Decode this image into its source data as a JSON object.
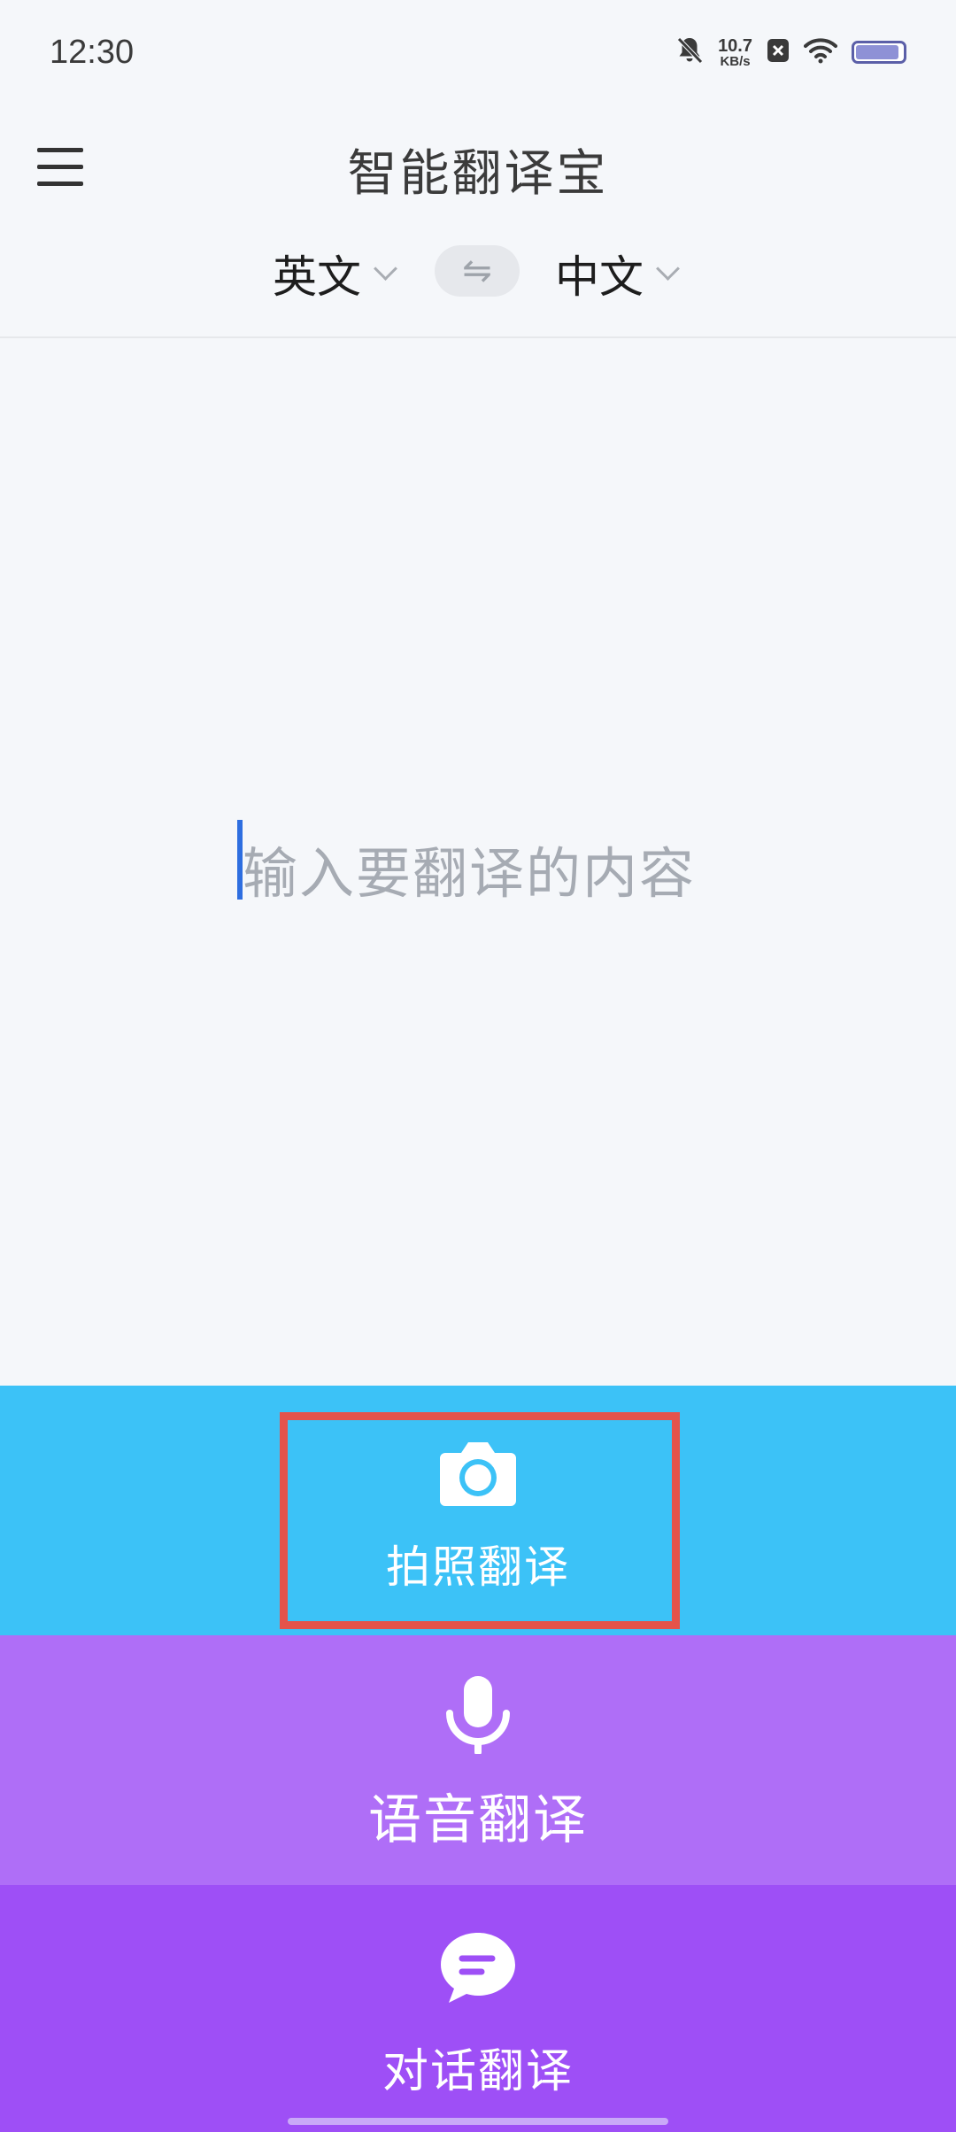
{
  "status_bar": {
    "time": "12:30",
    "net_speed_value": "10.7",
    "net_speed_unit": "KB/s",
    "icons": [
      "mute-bell-icon",
      "close-box-icon",
      "wifi-icon",
      "battery-icon"
    ],
    "battery_level": 0.85
  },
  "header": {
    "title": "智能翻译宝",
    "menu_icon": "hamburger-menu-icon",
    "source_lang": "英文",
    "target_lang": "中文",
    "swap_glyph": "⇋"
  },
  "input": {
    "placeholder": "输入要翻译的内容"
  },
  "actions": {
    "photo": {
      "label": "拍照翻译",
      "icon": "camera-icon",
      "color": "#3cc2f7"
    },
    "voice": {
      "label": "语音翻译",
      "icon": "microphone-icon",
      "color": "#af6ef7"
    },
    "chat": {
      "label": "对话翻译",
      "icon": "chat-bubble-icon",
      "color": "#9e4ff6"
    }
  },
  "colors": {
    "highlight": "#e5534b",
    "caret": "#2e6ee0"
  }
}
